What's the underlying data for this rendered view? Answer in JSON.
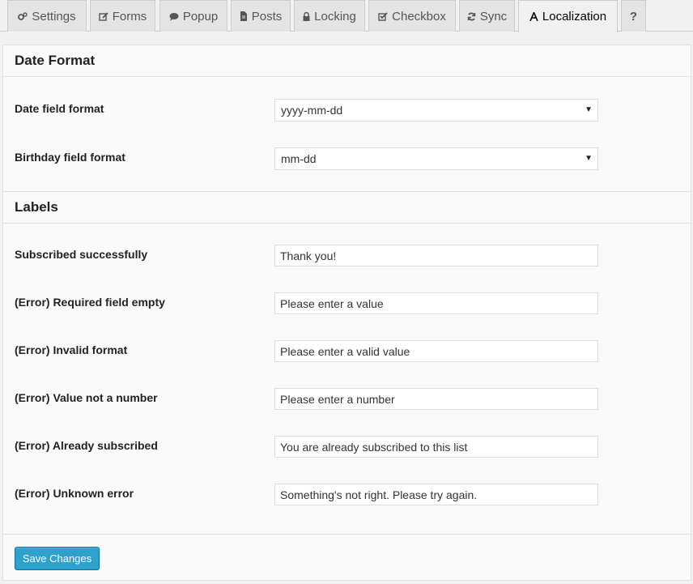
{
  "tabs": [
    {
      "label": "Settings",
      "icon": "gears-icon"
    },
    {
      "label": "Forms",
      "icon": "edit-icon"
    },
    {
      "label": "Popup",
      "icon": "comment-icon"
    },
    {
      "label": "Posts",
      "icon": "file-icon"
    },
    {
      "label": "Locking",
      "icon": "lock-icon"
    },
    {
      "label": "Checkbox",
      "icon": "checkbox-icon"
    },
    {
      "label": "Sync",
      "icon": "refresh-icon"
    },
    {
      "label": "Localization",
      "icon": "font-icon",
      "active": true
    },
    {
      "label": "?",
      "icon": "help-icon"
    }
  ],
  "date_format": {
    "title": "Date Format",
    "date_field": {
      "label": "Date field format",
      "value": "yyyy-mm-dd"
    },
    "birthday_field": {
      "label": "Birthday field format",
      "value": "mm-dd"
    }
  },
  "labels": {
    "title": "Labels",
    "fields": [
      {
        "label": "Subscribed successfully",
        "value": "Thank you!"
      },
      {
        "label": "(Error) Required field empty",
        "value": "Please enter a value"
      },
      {
        "label": "(Error) Invalid format",
        "value": "Please enter a valid value"
      },
      {
        "label": "(Error) Value not a number",
        "value": "Please enter a number"
      },
      {
        "label": "(Error) Already subscribed",
        "value": "You are already subscribed to this list"
      },
      {
        "label": "(Error) Unknown error",
        "value": "Something's not right. Please try again."
      }
    ]
  },
  "footer": {
    "save_label": "Save Changes"
  },
  "colors": {
    "accent": "#2ea2cc",
    "accent_border": "#0074a2"
  }
}
